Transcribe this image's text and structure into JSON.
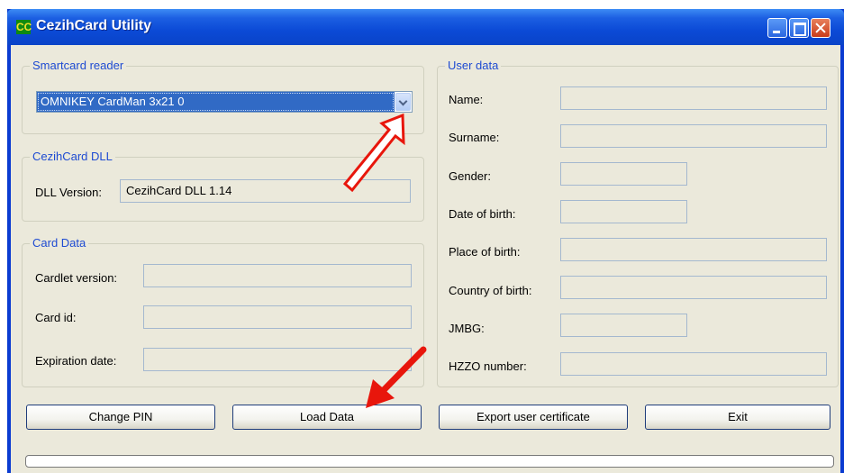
{
  "window": {
    "title": "CezihCard Utility",
    "icon_text": "CC",
    "icon_name": "cezihcard-app-icon"
  },
  "smartcard": {
    "group_title": "Smartcard reader",
    "selected_reader": "OMNIKEY CardMan 3x21 0"
  },
  "dll": {
    "group_title": "CezihCard DLL",
    "version_label": "DLL Version:",
    "version_value": "CezihCard DLL 1.14"
  },
  "card_data": {
    "group_title": "Card Data",
    "cardlet_version_label": "Cardlet version:",
    "card_id_label": "Card id:",
    "expiration_label": "Expiration date:"
  },
  "user_data": {
    "group_title": "User data",
    "name_label": "Name:",
    "surname_label": "Surname:",
    "gender_label": "Gender:",
    "dob_label": "Date of birth:",
    "pob_label": "Place of birth:",
    "cob_label": "Country of birth:",
    "jmbg_label": "JMBG:",
    "hzzo_label": "HZZO number:"
  },
  "buttons": {
    "change_pin": "Change PIN",
    "load_data": "Load Data",
    "export_cert": "Export user certificate",
    "exit": "Exit"
  },
  "progress": {
    "value": 0
  },
  "annotations": {
    "outline_arrow_color": "#e8160c",
    "solid_arrow_color": "#e8160c"
  }
}
